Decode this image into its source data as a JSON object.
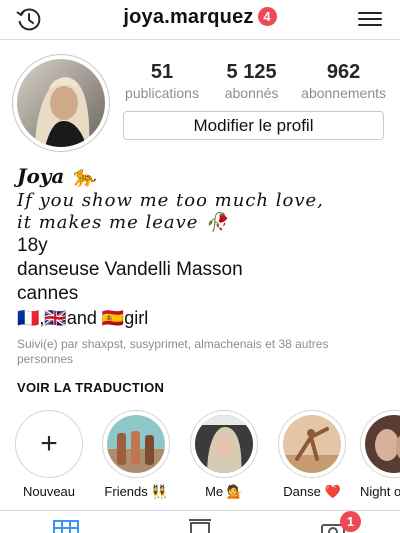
{
  "header": {
    "username": "joya.marquez",
    "notification_count": "4",
    "history_icon": "history-icon",
    "menu_icon": "hamburger-menu-icon"
  },
  "stats": [
    {
      "value": "51",
      "label": "publications"
    },
    {
      "value": "5 125",
      "label": "abonnés"
    },
    {
      "value": "962",
      "label": "abonnements"
    }
  ],
  "edit_profile_label": "Modifier le profil",
  "bio": {
    "name": "Joya 🐆",
    "quote_line1": "If you show me too much love,",
    "quote_line2": "it makes me leave 🥀",
    "line_age": "18y",
    "line_dance": "danseuse Vandelli Masson",
    "line_city": "cannes",
    "line_flags": "🇫🇷,🇬🇧and 🇪🇸girl",
    "followed_by": "Suivi(e) par shaxpst, susyprimet, almachenais et 38 autres personnes",
    "translate_label": "VOIR LA TRADUCTION"
  },
  "highlights": [
    {
      "label": "Nouveau",
      "icon": "plus-icon"
    },
    {
      "label": "Friends 👯"
    },
    {
      "label": "Me 💁"
    },
    {
      "label": "Danse ❤️"
    },
    {
      "label": "Night o"
    }
  ],
  "tabs": [
    {
      "icon": "grid-icon",
      "active": true
    },
    {
      "icon": "feed-list-icon",
      "active": false
    },
    {
      "icon": "tagged-photo-icon",
      "active": false,
      "badge": "1"
    }
  ],
  "colors": {
    "accent_blue": "#3897f0",
    "badge_red": "#ed4956",
    "muted_text": "#8e8e8e",
    "border": "#dbdbdb"
  }
}
